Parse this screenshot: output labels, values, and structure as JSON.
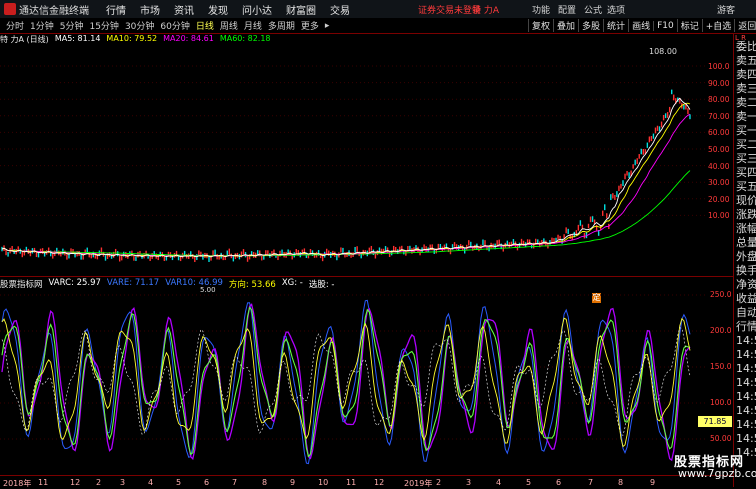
{
  "app": {
    "title": "通达信金融终端"
  },
  "menu": [
    "行情",
    "市场",
    "资讯",
    "发现",
    "问小达",
    "财富圈",
    "交易"
  ],
  "status": {
    "login": "证券交易未登录",
    "stock": "特 力A"
  },
  "right_menu": [
    "功能",
    "配置",
    "公式",
    "选项"
  ],
  "guest": "游客",
  "period_tabs": [
    "分时",
    "1分钟",
    "5分钟",
    "15分钟",
    "30分钟",
    "60分钟",
    "日线",
    "周线",
    "月线",
    "多周期",
    "更多"
  ],
  "active_tab": "日线",
  "tools": [
    "复权",
    "叠加",
    "多股",
    "统计",
    "画线",
    "F10",
    "标记",
    "+自选",
    "返回"
  ],
  "ma_bar": {
    "name": "特 力A (日线)",
    "items": [
      {
        "text": "MA5: 81.14",
        "color": "#ffffff"
      },
      {
        "text": "MA10: 79.52",
        "color": "#ffff00"
      },
      {
        "text": "MA20: 84.61",
        "color": "#ff00ff"
      },
      {
        "text": "MA60: 82.18",
        "color": "#00ff00"
      }
    ]
  },
  "price_ticks": [
    "100.0",
    "90.00",
    "80.00",
    "70.00",
    "60.00",
    "50.00",
    "40.00",
    "30.00",
    "20.00",
    "10.00"
  ],
  "peak_label": "108.00",
  "low_label": "5.00",
  "ding": "定",
  "indicator_bar": {
    "name": "股票指标网",
    "items": [
      {
        "text": "VARC: 25.97",
        "color": "#ffffff"
      },
      {
        "text": "VARE: 71.17",
        "color": "#3c78ff"
      },
      {
        "text": "VAR10: 46.99",
        "color": "#3c78ff"
      },
      {
        "text": "方向: 53.66",
        "color": "#ffff00"
      },
      {
        "text": "XG: -",
        "color": "#ffffff"
      },
      {
        "text": "选股: -",
        "color": "#ffffff"
      }
    ]
  },
  "ind_ticks": [
    "250.0",
    "200.0",
    "150.0",
    "100.0",
    "50.00"
  ],
  "value_label": "71.85",
  "sidebar_items": [
    "委比",
    "卖五",
    "卖四",
    "卖三",
    "卖二",
    "卖一",
    "买一",
    "买二",
    "买三",
    "买四",
    "买五",
    "现价",
    "涨跌",
    "涨幅",
    "总量",
    "外盘",
    "换手",
    "净资",
    "收益",
    "自动",
    "行情",
    "14:5",
    "14:5",
    "14:5",
    "14:5",
    "14:5",
    "14:5",
    "14:5",
    "14:5",
    "14:5"
  ],
  "side_top": "L R",
  "x_axis": [
    "2018年",
    "11",
    "12",
    "2",
    "3",
    "4",
    "5",
    "6",
    "7",
    "8",
    "9",
    "10",
    "11",
    "12",
    "2019年",
    "2",
    "3",
    "4",
    "5",
    "6",
    "7",
    "8",
    "9"
  ],
  "watermark": {
    "line1": "股票指标网",
    "line2": "www.7gpzb.com"
  },
  "chart_data": {
    "type": "line",
    "price_ylim": [
      0,
      110
    ],
    "indicator_ylim": [
      0,
      270
    ],
    "peak": 108.0
  }
}
